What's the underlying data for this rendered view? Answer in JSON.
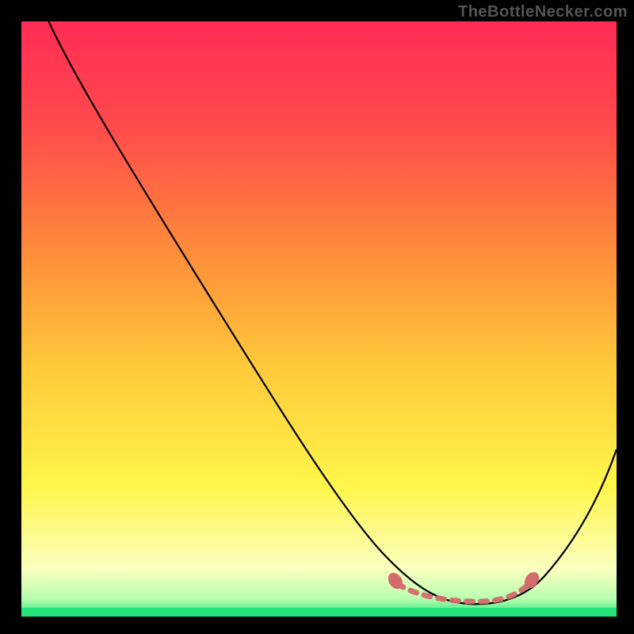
{
  "watermark": "TheBottleNecker.com",
  "chart_data": {
    "type": "line",
    "title": "",
    "xlabel": "",
    "ylabel": "",
    "xlim": [
      0,
      100
    ],
    "ylim": [
      0,
      100
    ],
    "background_gradient": {
      "top": "#ff2c55",
      "mid_top": "#ff6a3a",
      "mid_bottom": "#ffee3a",
      "near_bottom": "#f7ffb0",
      "bottom": "#22e37a"
    },
    "band": {
      "y_from": 0,
      "y_to": 1.5,
      "color": "#22e37a"
    },
    "curve": {
      "description": "Bottleneck curve — high value = bad (red), low value near sweet spot = good (green). Steep descent from x≈4,y≈100 to a flat minimum around x≈68–82, y≈2, then rises again to x≈100,y≈28.",
      "x": [
        4,
        10,
        20,
        30,
        40,
        50,
        55,
        60,
        64,
        68,
        72,
        76,
        80,
        84,
        88,
        92,
        96,
        100
      ],
      "y": [
        100,
        90,
        74,
        58,
        43,
        28,
        20,
        13,
        7,
        3,
        2,
        2,
        2,
        4,
        9,
        15,
        21,
        28
      ]
    },
    "optimal_marker": {
      "x_from": 62,
      "x_to": 84,
      "y": 3,
      "style": "dashed",
      "color": "#d46a6a",
      "end_bumps": true
    }
  }
}
